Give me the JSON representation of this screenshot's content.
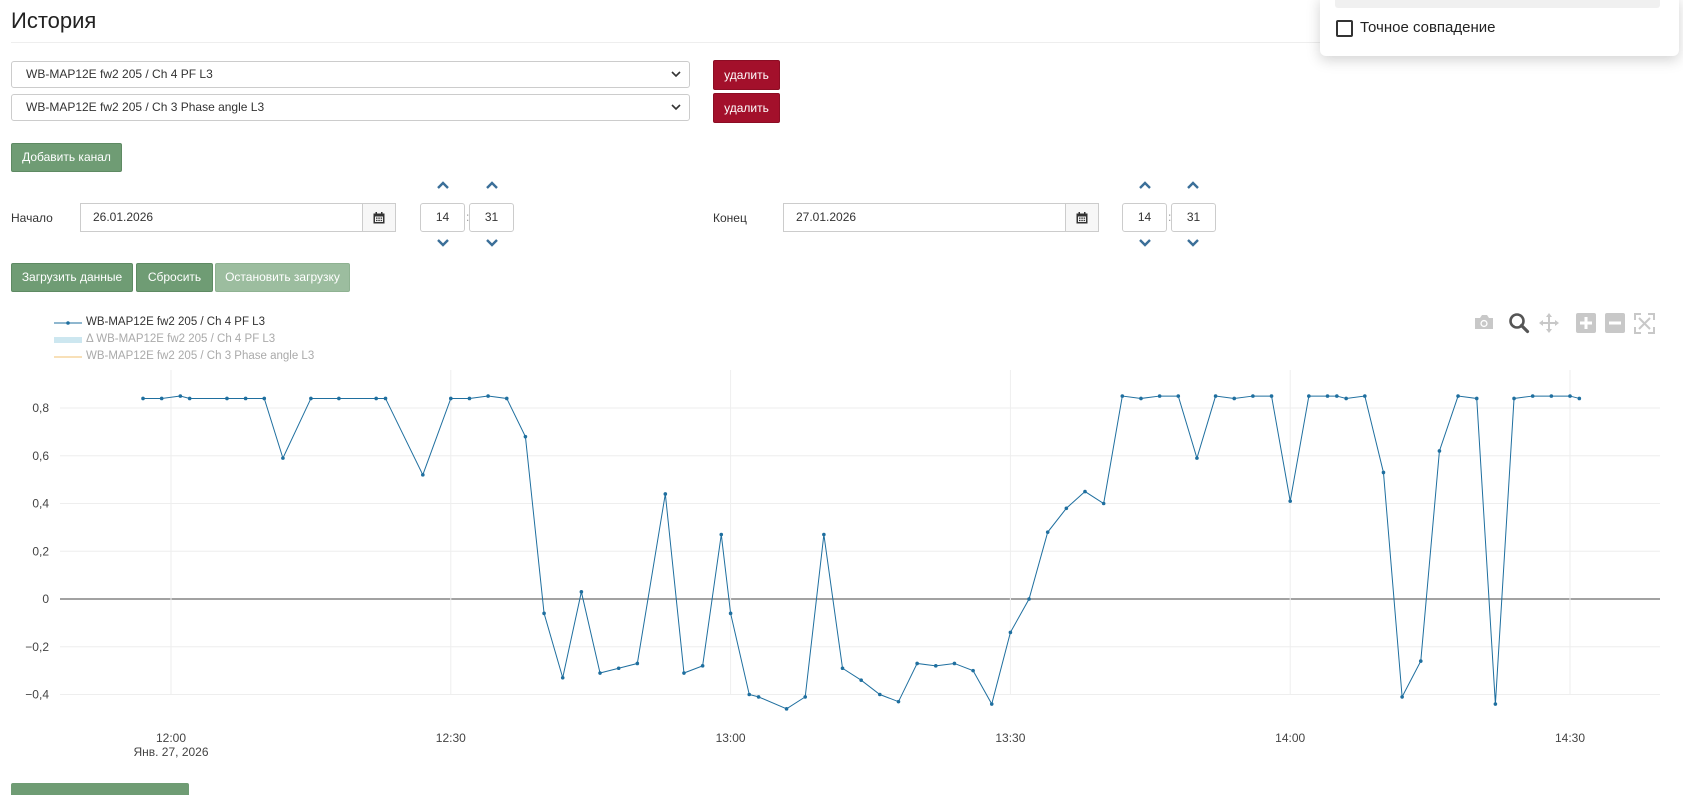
{
  "page": {
    "title": "История"
  },
  "search_popup": {
    "exact_match_label": "Точное совпадение",
    "exact_match_checked": false
  },
  "channels": [
    {
      "value": "WB-MAP12E fw2 205 / Ch 4 PF L3",
      "delete_label": "удалить"
    },
    {
      "value": "WB-MAP12E fw2 205 / Ch 3 Phase angle L3",
      "delete_label": "удалить"
    }
  ],
  "add_channel_label": "Добавить канал",
  "range": {
    "start_label": "Начало",
    "start_date": "26.01.2026",
    "start_hour": "14",
    "start_minute": "31",
    "end_label": "Конец",
    "end_date": "27.01.2026",
    "end_hour": "14",
    "end_minute": "31",
    "time_separator": ":"
  },
  "actions": {
    "load": "Загрузить данные",
    "reset": "Сбросить",
    "stop": "Остановить загрузку"
  },
  "icons": {
    "calendar": "calendar-icon",
    "chevron_up": "chevron-up-icon",
    "chevron_down": "chevron-down-icon",
    "camera": "camera-icon",
    "zoom": "zoom-icon",
    "pan": "pan-icon",
    "zoom_in": "zoom-in-icon",
    "zoom_out": "zoom-out-icon",
    "autoscale": "autoscale-icon"
  },
  "colors": {
    "danger": "#a3102b",
    "success": "#6f9c74",
    "success_disabled": "#9cbd9f",
    "line": "#1f6f9f",
    "legend_delta": "#b8dde9",
    "legend_phase": "#f0c070"
  },
  "chart_data": {
    "type": "line",
    "xlabel": "",
    "ylabel": "",
    "x_ticks": [
      "12:00",
      "12:30",
      "13:00",
      "13:30",
      "14:00",
      "14:30"
    ],
    "x_date_label": "Янв. 27, 2026",
    "y_ticks": [
      "0,8",
      "0,6",
      "0,4",
      "0,2",
      "0",
      "−0,2",
      "−0,4"
    ],
    "ylim": [
      -0.5,
      0.88
    ],
    "xlim": [
      "2026-01-27 11:52",
      "2026-01-27 14:40"
    ],
    "legend_position": "top-left",
    "grid": true,
    "series": [
      {
        "name": "WB-MAP12E fw2 205 / Ch 4 PF L3",
        "x": [
          "11:57",
          "11:59",
          "12:01",
          "12:02",
          "12:06",
          "12:08",
          "12:10",
          "12:12",
          "12:15",
          "12:18",
          "12:22",
          "12:23",
          "12:27",
          "12:30",
          "12:32",
          "12:34",
          "12:36",
          "12:38",
          "12:40",
          "12:42",
          "12:44",
          "12:46",
          "12:48",
          "12:50",
          "12:53",
          "12:55",
          "12:57",
          "12:59",
          "13:00",
          "13:02",
          "13:03",
          "13:06",
          "13:08",
          "13:10",
          "13:12",
          "13:14",
          "13:16",
          "13:18",
          "13:20",
          "13:22",
          "13:24",
          "13:26",
          "13:28",
          "13:30",
          "13:32",
          "13:34",
          "13:36",
          "13:38",
          "13:40",
          "13:42",
          "13:44",
          "13:46",
          "13:48",
          "13:50",
          "13:52",
          "13:54",
          "13:56",
          "13:58",
          "14:00",
          "14:02",
          "14:04",
          "14:05",
          "14:06",
          "14:08",
          "14:10",
          "14:12",
          "14:14",
          "14:16",
          "14:18",
          "14:20",
          "14:22",
          "14:24",
          "14:26",
          "14:28",
          "14:30",
          "14:31"
        ],
        "y": [
          0.84,
          0.84,
          0.85,
          0.84,
          0.84,
          0.84,
          0.84,
          0.59,
          0.84,
          0.84,
          0.84,
          0.84,
          0.52,
          0.84,
          0.84,
          0.85,
          0.84,
          0.68,
          -0.06,
          -0.33,
          0.03,
          -0.31,
          -0.29,
          -0.27,
          0.44,
          -0.31,
          -0.28,
          0.27,
          -0.06,
          -0.4,
          -0.41,
          -0.46,
          -0.41,
          0.27,
          -0.29,
          -0.34,
          -0.4,
          -0.43,
          -0.27,
          -0.28,
          -0.27,
          -0.3,
          -0.44,
          -0.14,
          0.0,
          0.28,
          0.38,
          0.45,
          0.4,
          0.85,
          0.84,
          0.85,
          0.85,
          0.59,
          0.85,
          0.84,
          0.85,
          0.85,
          0.41,
          0.85,
          0.85,
          0.85,
          0.84,
          0.85,
          0.53,
          -0.41,
          -0.26,
          0.62,
          0.85,
          0.84,
          -0.44,
          0.84,
          0.85,
          0.85,
          0.85,
          0.84
        ]
      },
      {
        "name": "Δ WB-MAP12E fw2 205 / Ch 4 PF L3",
        "x": [],
        "y": []
      },
      {
        "name": "WB-MAP12E fw2 205 / Ch 3 Phase angle L3",
        "x": [],
        "y": []
      }
    ]
  }
}
